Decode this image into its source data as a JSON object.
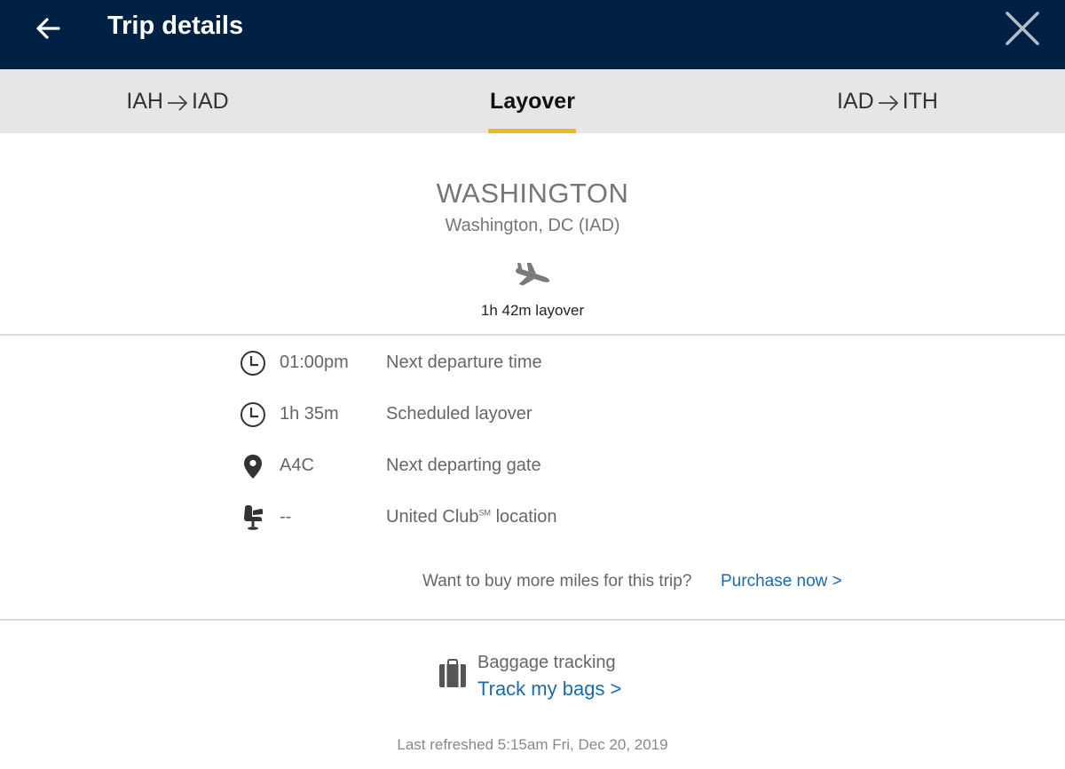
{
  "header": {
    "title": "Trip details",
    "back_icon": "back-arrow-icon",
    "close_icon": "close-icon",
    "background": "#002144"
  },
  "tabs": [
    {
      "from": "IAH",
      "to": "IAD",
      "selected": false
    },
    {
      "label": "Layover",
      "selected": true
    },
    {
      "from": "IAD",
      "to": "ITH",
      "selected": false
    }
  ],
  "accent_color": "#f2b81d",
  "layover": {
    "city": "WASHINGTON",
    "airport": "Washington, DC (IAD)",
    "plane_icon": "airplane-landing-icon",
    "duration": "1h 42m layover"
  },
  "details": [
    {
      "icon": "clock-icon",
      "value": "01:00pm",
      "label": "Next departure time"
    },
    {
      "icon": "clock-icon",
      "value": "1h 35m",
      "label": "Scheduled layover"
    },
    {
      "icon": "map-pin-icon",
      "value": "A4C",
      "label": "Next departing gate"
    },
    {
      "icon": "lounge-chair-icon",
      "value": "--",
      "label": "United Club",
      "label_sup": "SM",
      "label_suffix": " location"
    }
  ],
  "miles": {
    "question": "Want to buy more miles for this trip?",
    "link": "Purchase now >"
  },
  "baggage": {
    "icon": "suitcase-icon",
    "label": "Baggage tracking",
    "link": "Track my bags >"
  },
  "footer": {
    "last_refreshed": "Last refreshed 5:15am Fri, Dec 20, 2019"
  },
  "link_color": "#1c6aa8"
}
